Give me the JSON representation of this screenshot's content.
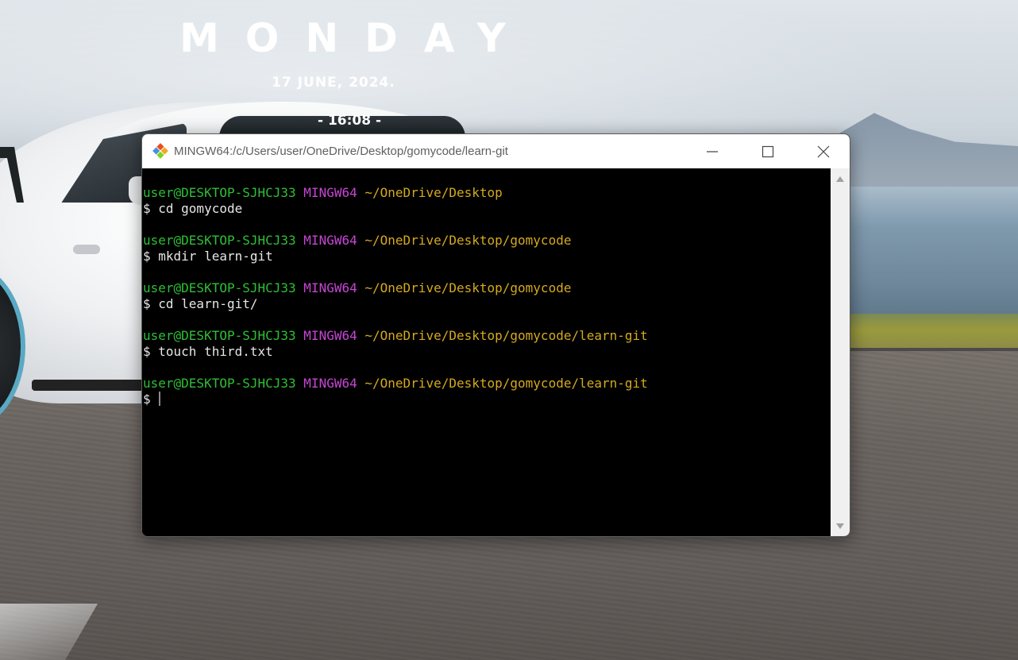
{
  "widget": {
    "day": "MONDAY",
    "date": "17 JUNE, 2024.",
    "time": "- 16:08 -"
  },
  "window": {
    "title": "MINGW64:/c/Users/user/OneDrive/Desktop/gomycode/learn-git",
    "controls": {
      "minimize": "minimize",
      "maximize": "maximize",
      "close": "close"
    }
  },
  "terminal": {
    "user_host": "user@DESKTOP-SJHCJ33",
    "shell": "MINGW64",
    "lines": [
      {
        "path": "~/OneDrive/Desktop",
        "command": "$ cd gomycode"
      },
      {
        "path": "~/OneDrive/Desktop/gomycode",
        "command": "$ mkdir learn-git"
      },
      {
        "path": "~/OneDrive/Desktop/gomycode",
        "command": "$ cd learn-git/"
      },
      {
        "path": "~/OneDrive/Desktop/gomycode/learn-git",
        "command": "$ touch third.txt"
      },
      {
        "path": "~/OneDrive/Desktop/gomycode/learn-git",
        "command": "$ "
      }
    ]
  },
  "colors": {
    "user_host": "#2fbf35",
    "shell": "#c845d6",
    "path": "#d4a91f",
    "background": "#000000"
  },
  "icons": {
    "app": "git-bash-icon",
    "minimize": "minimize-icon",
    "maximize": "maximize-icon",
    "close": "close-icon",
    "scroll_up": "scroll-up-arrow-icon",
    "scroll_down": "scroll-down-arrow-icon"
  }
}
